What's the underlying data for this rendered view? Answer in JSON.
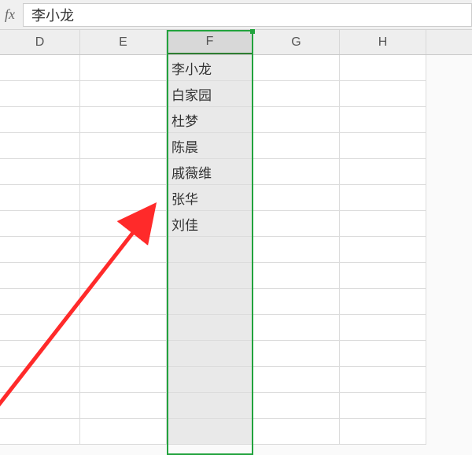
{
  "formula_bar": {
    "fx_label": "fx",
    "value": "李小龙"
  },
  "columns": [
    "D",
    "E",
    "F",
    "G",
    "H"
  ],
  "selected_column_index": 2,
  "rows": [
    {
      "F": "李小龙"
    },
    {
      "F": "白家园"
    },
    {
      "F": "杜梦"
    },
    {
      "F": "陈晨"
    },
    {
      "F": "戚薇维"
    },
    {
      "F": "张华"
    },
    {
      "F": "刘佳"
    },
    {
      "F": ""
    },
    {
      "F": ""
    },
    {
      "F": ""
    },
    {
      "F": ""
    },
    {
      "F": ""
    },
    {
      "F": ""
    },
    {
      "F": ""
    },
    {
      "F": ""
    }
  ],
  "annotation": {
    "type": "arrow",
    "color": "#ff2a2a"
  }
}
